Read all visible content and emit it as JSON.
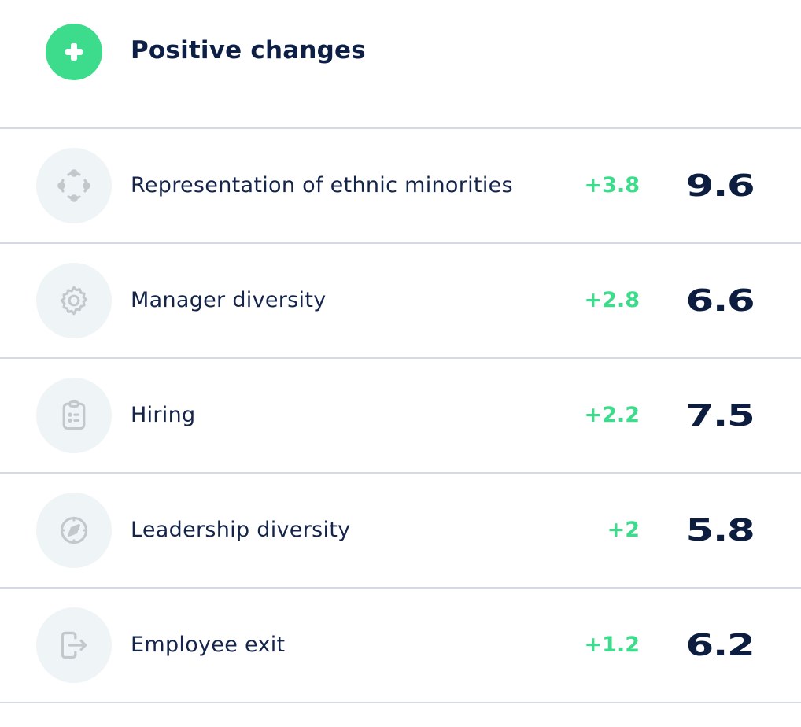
{
  "header": {
    "icon": "plus-icon",
    "title": "Positive changes",
    "accent_color": "#3ddc8c"
  },
  "rows": [
    {
      "icon": "network-nodes-icon",
      "label": "Representation of ethnic minorities",
      "delta": "+3.8",
      "value": "9.6"
    },
    {
      "icon": "gear-icon",
      "label": "Manager diversity",
      "delta": "+2.8",
      "value": "6.6"
    },
    {
      "icon": "clipboard-list-icon",
      "label": "Hiring",
      "delta": "+2.2",
      "value": "7.5"
    },
    {
      "icon": "compass-icon",
      "label": "Leadership diversity",
      "delta": "+2",
      "value": "5.8"
    },
    {
      "icon": "exit-icon",
      "label": "Employee exit",
      "delta": "+1.2",
      "value": "6.2"
    }
  ]
}
